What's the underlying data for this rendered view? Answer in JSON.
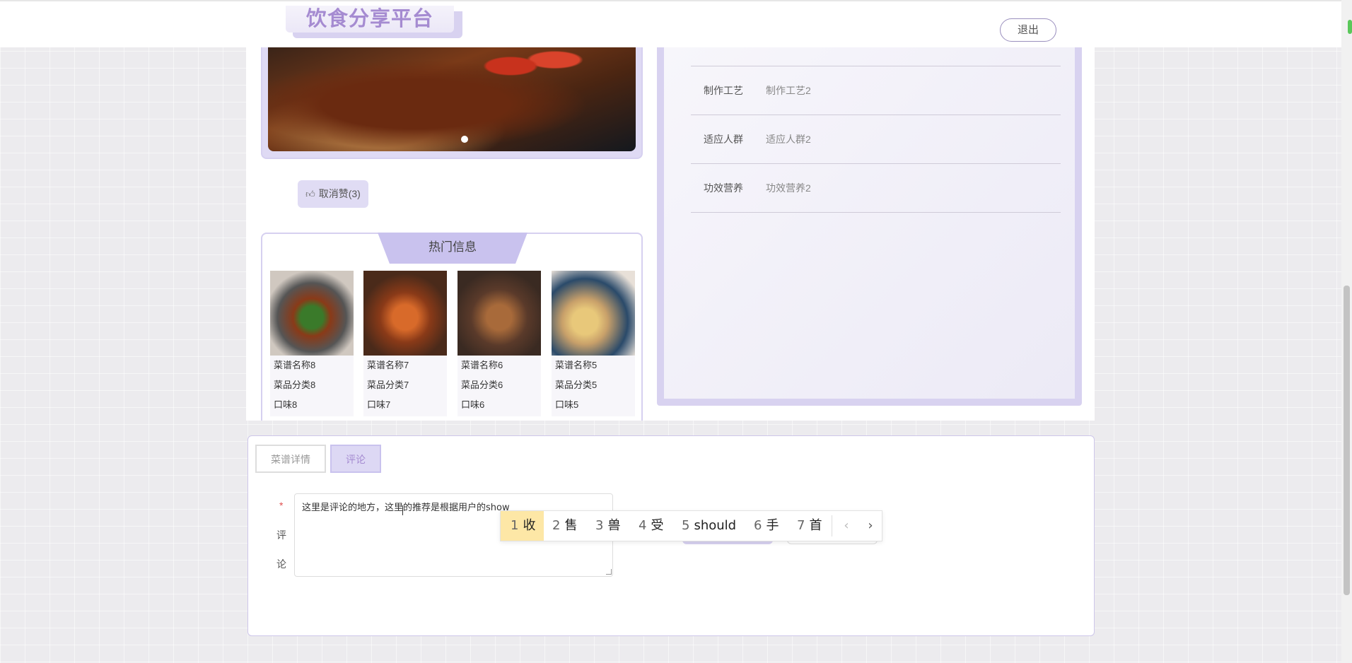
{
  "header": {
    "logo_text": "饮食分享平台",
    "logout_label": "退出"
  },
  "like": {
    "label": "取消赞(3)",
    "icon": "thumbs-up-icon"
  },
  "hot": {
    "title": "热门信息",
    "items": [
      {
        "name": "菜谱名称8",
        "category": "菜品分类8",
        "taste": "口味8"
      },
      {
        "name": "菜谱名称7",
        "category": "菜品分类7",
        "taste": "口味7"
      },
      {
        "name": "菜谱名称6",
        "category": "菜品分类6",
        "taste": "口味6"
      },
      {
        "name": "菜谱名称5",
        "category": "菜品分类5",
        "taste": "口味5"
      }
    ]
  },
  "info": {
    "rows": [
      {
        "key": "制作工艺",
        "value": "制作工艺2"
      },
      {
        "key": "适应人群",
        "value": "适应人群2"
      },
      {
        "key": "功效营养",
        "value": "功效营养2"
      }
    ]
  },
  "tabs": {
    "detail": "菜谱详情",
    "comment": "评论"
  },
  "comment": {
    "required_mark": "*",
    "label_1": "评",
    "label_2": "论",
    "value": "这里是评论的地方，这里的推荐是根据用户的show"
  },
  "ime": {
    "candidates": [
      {
        "num": "1",
        "text": "收"
      },
      {
        "num": "2",
        "text": "售"
      },
      {
        "num": "3",
        "text": "兽"
      },
      {
        "num": "4",
        "text": "受"
      },
      {
        "num": "5",
        "text": "should"
      },
      {
        "num": "6",
        "text": "手"
      },
      {
        "num": "7",
        "text": "首"
      }
    ],
    "prev": "‹",
    "next": "›"
  },
  "colors": {
    "accent": "#a58bd1",
    "panel": "#d8d2f0"
  }
}
